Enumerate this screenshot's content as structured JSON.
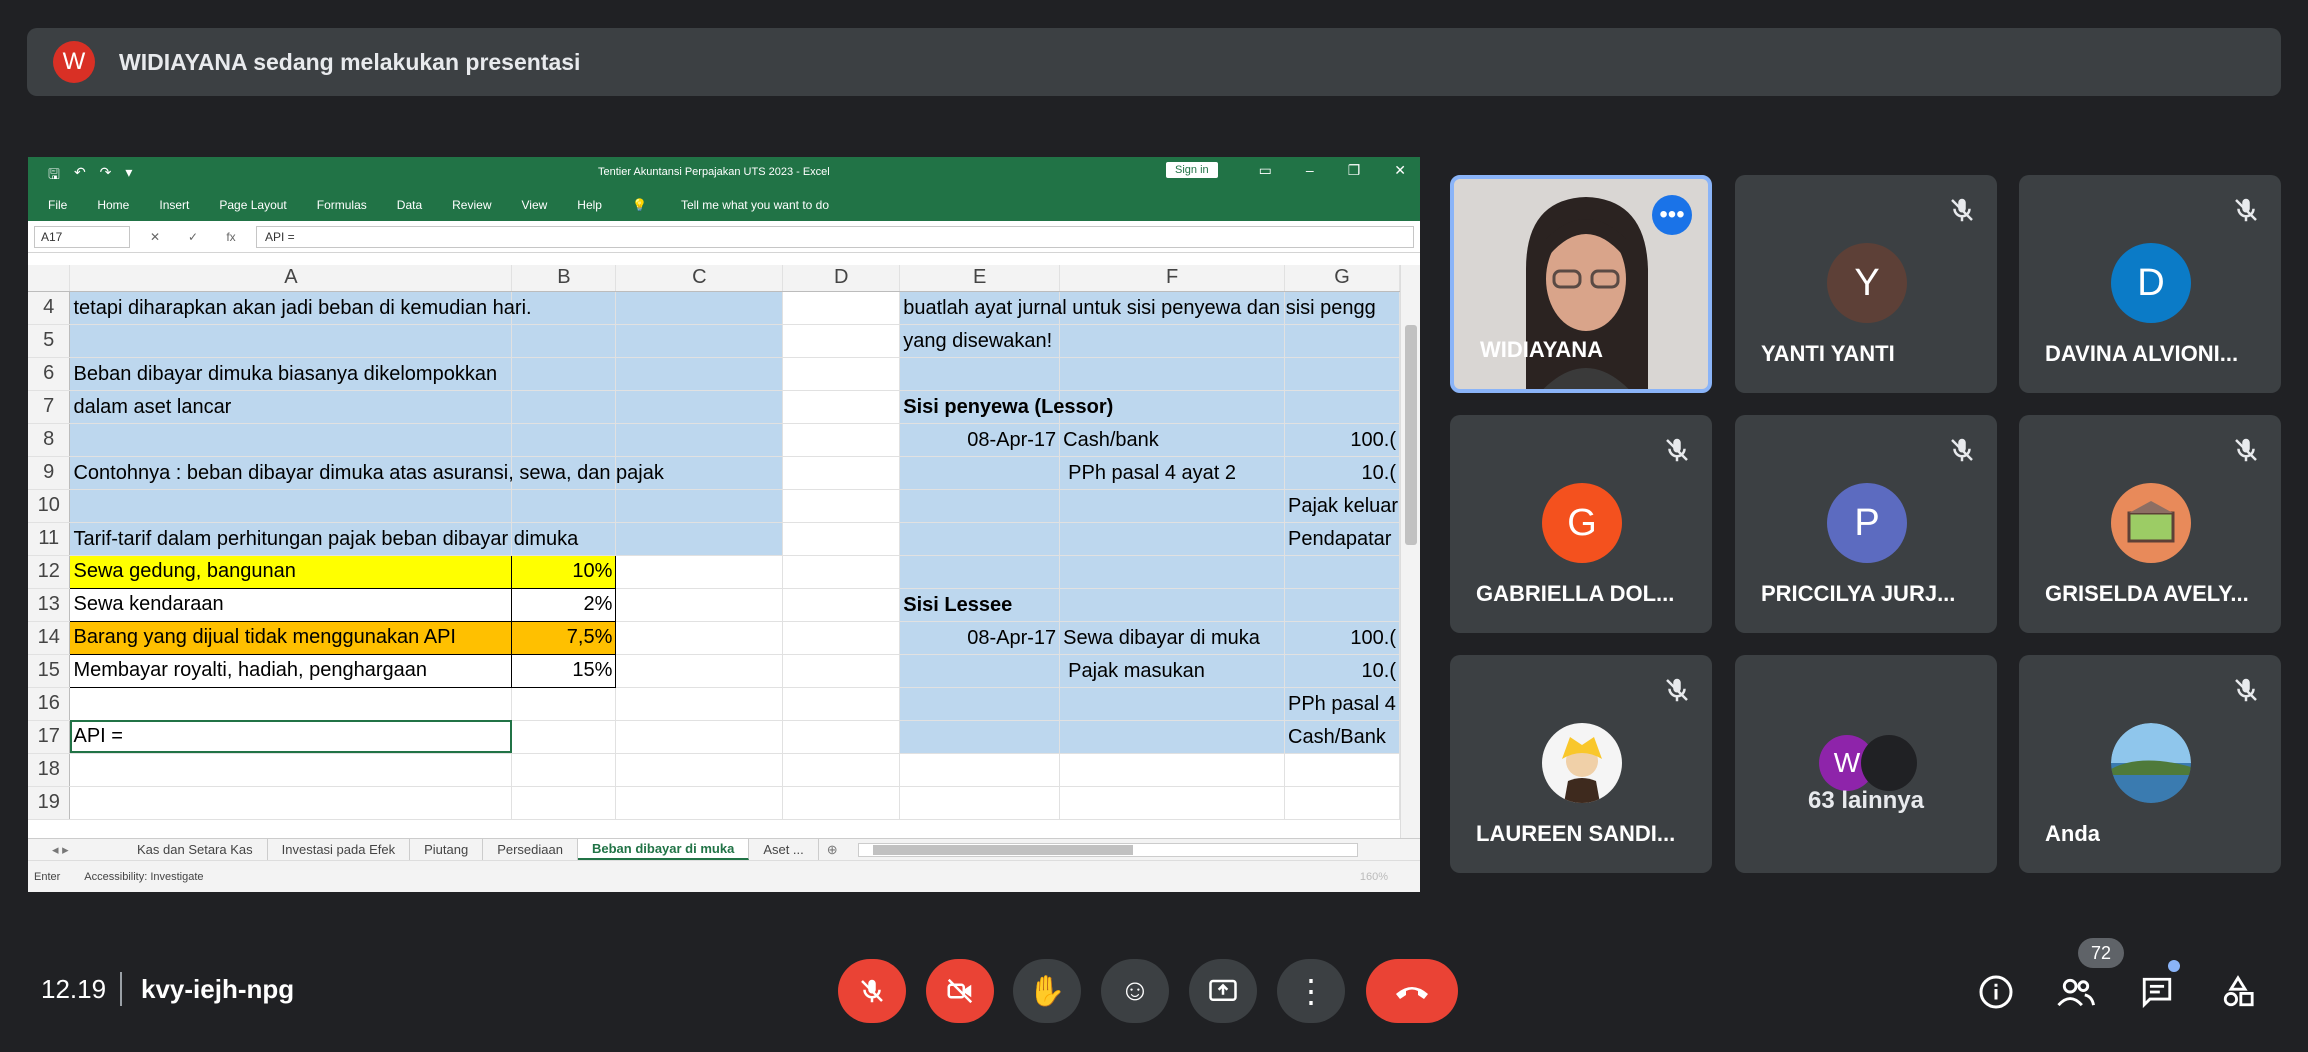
{
  "banner": {
    "initial": "W",
    "text": "WIDIAYANA sedang melakukan presentasi",
    "avatar_color": "#d93025"
  },
  "excel": {
    "doc_title": "Tentier Akuntansi Perpajakan UTS 2023 - Excel",
    "sign_in": "Sign in",
    "ribbon": [
      "File",
      "Home",
      "Insert",
      "Page Layout",
      "Formulas",
      "Data",
      "Review",
      "View",
      "Help"
    ],
    "tell_me": "Tell me what you want to do",
    "name_box": "A17",
    "formula": "API =",
    "columns": [
      "A",
      "B",
      "C",
      "D",
      "E",
      "F",
      "G"
    ],
    "rows": {
      "r4": {
        "num": "4",
        "a": "tetapi diharapkan akan jadi beban di kemudian hari.",
        "e": "buatlah ayat jurnal untuk sisi penyewa dan sisi pengg"
      },
      "r5": {
        "num": "5",
        "e": "yang disewakan!"
      },
      "r6": {
        "num": "6",
        "a": "Beban dibayar dimuka biasanya dikelompokkan"
      },
      "r7": {
        "num": "7",
        "a": "dalam aset lancar",
        "e": "Sisi penyewa (Lessor)"
      },
      "r8": {
        "num": "8",
        "e": "08-Apr-17",
        "f": "Cash/bank",
        "g": "100.("
      },
      "r9": {
        "num": "9",
        "a": "Contohnya : beban dibayar dimuka atas asuransi, sewa, dan pajak",
        "f": "PPh pasal 4 ayat 2",
        "g": "10.("
      },
      "r10": {
        "num": "10",
        "g": "Pajak keluar"
      },
      "r11": {
        "num": "11",
        "a": "Tarif-tarif dalam perhitungan pajak beban dibayar dimuka",
        "g": "Pendapatar"
      },
      "r12": {
        "num": "12",
        "a": "Sewa gedung, bangunan",
        "b": "10%"
      },
      "r13": {
        "num": "13",
        "a": "Sewa kendaraan",
        "b": "2%",
        "e": "Sisi Lessee"
      },
      "r14": {
        "num": "14",
        "a": "Barang yang dijual tidak menggunakan API",
        "b": "7,5%",
        "e": "08-Apr-17",
        "f": "Sewa dibayar di muka",
        "g": "100.("
      },
      "r15": {
        "num": "15",
        "a": "Membayar royalti, hadiah, penghargaan",
        "b": "15%",
        "f": "Pajak masukan",
        "g": "10.("
      },
      "r16": {
        "num": "16",
        "g": "PPh pasal 4"
      },
      "r17": {
        "num": "17",
        "a": "API =",
        "g": "Cash/Bank"
      },
      "r18": {
        "num": "18"
      },
      "r19": {
        "num": "19"
      }
    },
    "sheet_tabs": [
      "Kas dan Setara Kas",
      "Investasi pada Efek",
      "Piutang",
      "Persediaan",
      "Beban dibayar di muka",
      "Aset ..."
    ],
    "status_mode": "Enter",
    "accessibility": "Accessibility: Investigate",
    "zoom": "160%"
  },
  "participants": [
    {
      "name": "WIDIAYANA"
    },
    {
      "name": "YANTI YANTI",
      "initial": "Y",
      "color": "#5d4037"
    },
    {
      "name": "DAVINA ALVIONI...",
      "initial": "D",
      "color": "#0b7bc7"
    },
    {
      "name": "GABRIELLA DOL...",
      "initial": "G",
      "color": "#f4511e"
    },
    {
      "name": "PRICCILYA JURJ...",
      "initial": "P",
      "color": "#5c6bc0"
    },
    {
      "name": "GRISELDA AVELY..."
    },
    {
      "name": "LAUREEN SANDI..."
    },
    {
      "name": "Anda"
    }
  ],
  "others": {
    "initial": "W",
    "label": "63 lainnya",
    "color": "#8e24aa"
  },
  "footer": {
    "time": "12.19",
    "meeting_code": "kvy-iejh-npg",
    "people_count": "72"
  }
}
